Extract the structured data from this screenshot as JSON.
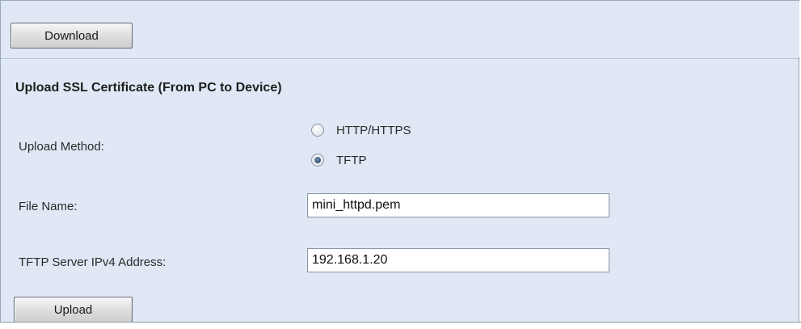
{
  "download_button": {
    "label": "Download"
  },
  "upload_section": {
    "title": "Upload SSL Certificate (From PC to Device)",
    "upload_method": {
      "label": "Upload Method:",
      "options": [
        {
          "label": "HTTP/HTTPS",
          "selected": false
        },
        {
          "label": "TFTP",
          "selected": true
        }
      ]
    },
    "file_name": {
      "label": "File Name:",
      "value": "mini_httpd.pem"
    },
    "tftp_server": {
      "label": "TFTP Server IPv4 Address:",
      "value": "192.168.1.20"
    },
    "upload_button": {
      "label": "Upload"
    }
  },
  "colors": {
    "panel_background": "#dfe8f4",
    "button_border": "#5f6872",
    "radio_selected": "#1f3d5e"
  }
}
